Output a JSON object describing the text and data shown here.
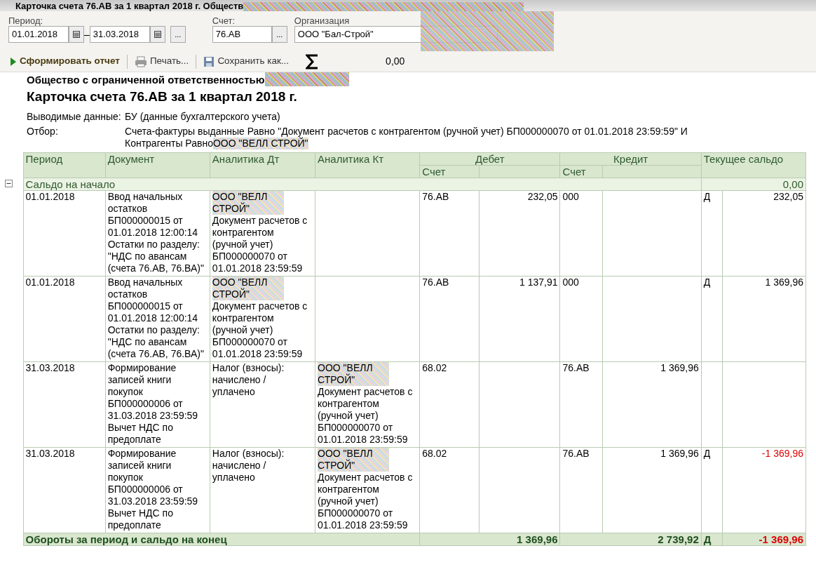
{
  "window": {
    "title": "Карточка счета 76.АВ за 1 квартал 2018 г. Обществ"
  },
  "params": {
    "period_label": "Период:",
    "date_from": "01.01.2018",
    "dash": "–",
    "date_to": "31.03.2018",
    "more": "...",
    "account_label": "Счет:",
    "account": "76.АВ",
    "account_more": "...",
    "org_label": "Организация",
    "org": "ООО \"Бал-Строй\""
  },
  "toolbar": {
    "buttons": [
      {
        "kind": "run",
        "label": "Сформировать отчет"
      },
      {
        "kind": "print",
        "label": "Печать..."
      },
      {
        "kind": "save",
        "label": "Сохранить как..."
      }
    ],
    "sum": "0,00"
  },
  "report": {
    "company": "Общество с ограниченной ответственностью",
    "title": "Карточка счета 76.АВ за 1 квартал 2018 г.",
    "output_label": "Выводимые данные:",
    "output_value": "БУ (данные бухгалтерского учета)",
    "filter_label": "Отбор:",
    "filter_line": "Счета-фактуры выданные Равно \"Документ расчетов с контрагентом (ручной учет) БП000000070 от 01.01.2018 23:59:59\" И",
    "filter_prefix": "Контрагенты Равно",
    "filter_party": "ООО \"ВЕЛЛ СТРОЙ\""
  },
  "table": {
    "columns": [
      "Период",
      "Документ",
      "Аналитика Дт",
      "Аналитика Кт"
    ],
    "debit": "Дебет",
    "credit": "Кредит",
    "balance": "Текущее сальдо",
    "sub_debit": "Счет",
    "sub_credit": "Счет",
    "opening": {
      "label": "Сальдо на начало",
      "value": "0,00",
      "expanded": true
    },
    "rows": [
      {
        "period": "01.01.2018",
        "document": "Ввод начальных остатков БП000000015 от 01.01.2018 12:00:14 Остатки по разделу: \"НДС по авансам (счета 76.АВ, 76.ВА)\"",
        "dt": {
          "party": "ООО \"ВЕЛЛ СТРОЙ\"",
          "text": "Документ расчетов с контрагентом (ручной учет) БП000000070 от 01.01.2018 23:59:59"
        },
        "kt": null,
        "debit_account": "76.АВ",
        "debit_amount": "232,05",
        "credit_account": "000",
        "credit_amount": "",
        "side": "Д",
        "balance": "232,05",
        "negative": false
      },
      {
        "period": "01.01.2018",
        "document": "Ввод начальных остатков БП000000015 от 01.01.2018 12:00:14 Остатки по разделу: \"НДС по авансам (счета 76.АВ, 76.ВА)\"",
        "dt": {
          "party": "ООО \"ВЕЛЛ СТРОЙ\"",
          "text": "Документ расчетов с контрагентом (ручной учет) БП000000070 от 01.01.2018 23:59:59"
        },
        "kt": null,
        "debit_account": "76.АВ",
        "debit_amount": "1 137,91",
        "credit_account": "000",
        "credit_amount": "",
        "side": "Д",
        "balance": "1 369,96",
        "negative": false
      },
      {
        "period": "31.03.2018",
        "document": "Формирование записей книги покупок БП000000006 от 31.03.2018 23:59:59 Вычет НДС по предоплате",
        "dt": {
          "text": "Налог (взносы): начислено / уплачено"
        },
        "kt": {
          "party": "ООО \"ВЕЛЛ СТРОЙ\"",
          "text": "Документ расчетов с контрагентом (ручной учет) БП000000070 от 01.01.2018 23:59:59"
        },
        "debit_account": "68.02",
        "debit_amount": "",
        "credit_account": "76.АВ",
        "credit_amount": "1 369,96",
        "side": "",
        "balance": ""
      },
      {
        "period": "31.03.2018",
        "document": "Формирование записей книги покупок БП000000006 от 31.03.2018 23:59:59 Вычет НДС по предоплате",
        "dt": {
          "text": "Налог (взносы): начислено / уплачено"
        },
        "kt": {
          "party": "ООО \"ВЕЛЛ СТРОЙ\"",
          "text": "Документ расчетов с контрагентом (ручной учет) БП000000070 от 01.01.2018 23:59:59"
        },
        "debit_account": "68.02",
        "debit_amount": "",
        "credit_account": "76.АВ",
        "credit_amount": "1 369,96",
        "side": "Д",
        "balance": "-1 369,96",
        "negative": true
      }
    ],
    "totals": {
      "label": "Обороты за период и сальдо на конец",
      "debit": "1 369,96",
      "credit": "2 739,92",
      "side": "Д",
      "balance": "-1 369,96",
      "negative": true
    }
  }
}
